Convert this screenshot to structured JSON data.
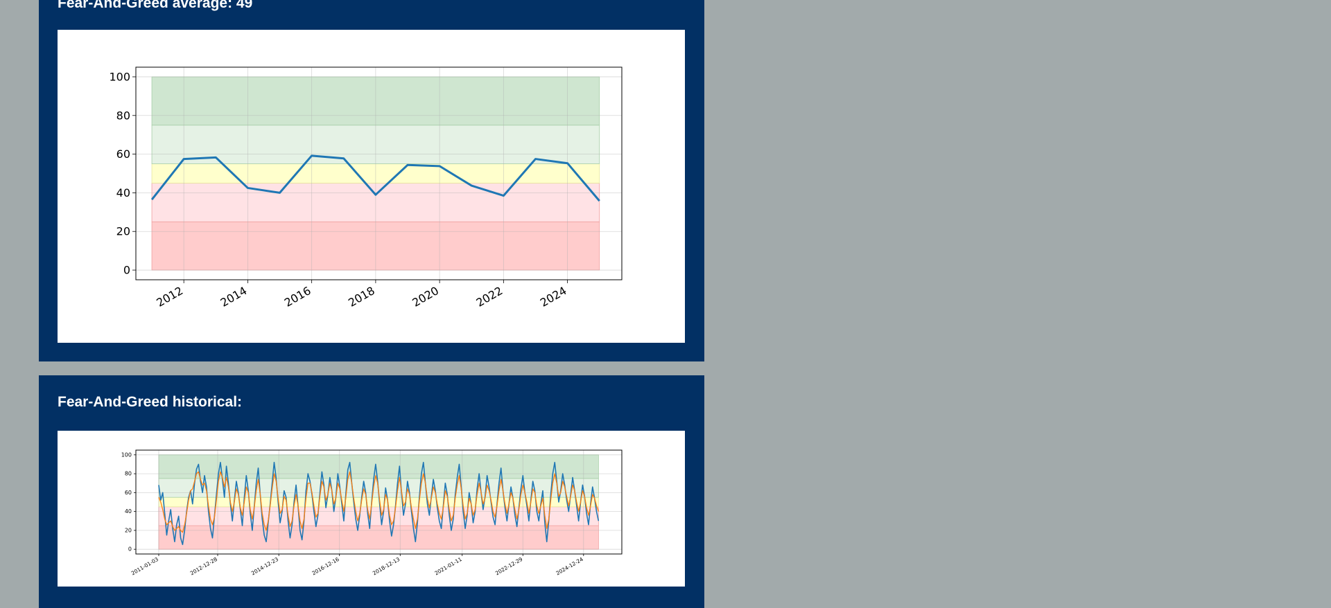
{
  "avg_panel": {
    "title": "Fear-And-Greed average: 49"
  },
  "hist_panel": {
    "title": "Fear-And-Greed historical:"
  },
  "colors": {
    "panel_bg": "#023064",
    "page_bg": "#a2aaab",
    "line": "#1f77b4",
    "ma_line": "#ff7f0e",
    "extreme_greed_band": "#cfe6d0",
    "greed_band": "#e5f2e5",
    "neutral_band": "#ffffcc",
    "fear_band": "#ffe2e5",
    "extreme_fear_band": "#ffcccc"
  },
  "chart_data": [
    {
      "type": "line",
      "title": "",
      "x": [
        2011,
        2012,
        2013,
        2014,
        2015,
        2016,
        2017,
        2018,
        2019,
        2020,
        2021,
        2022,
        2023,
        2024,
        2025
      ],
      "series": [
        {
          "values": [
            36.5,
            57.5,
            58.3,
            42.5,
            40.0,
            59.2,
            57.8,
            39.0,
            54.4,
            53.8,
            43.7,
            38.5,
            57.5,
            55.3,
            35.8
          ]
        }
      ],
      "bands": [
        {
          "from": 0,
          "to": 25,
          "color": "#ffcccc"
        },
        {
          "from": 25,
          "to": 45,
          "color": "#ffe2e5"
        },
        {
          "from": 45,
          "to": 55,
          "color": "#ffffcc"
        },
        {
          "from": 55,
          "to": 75,
          "color": "#e5f2e5"
        },
        {
          "from": 75,
          "to": 100,
          "color": "#cfe6d0"
        }
      ],
      "xticks": [
        "2012",
        "2014",
        "2016",
        "2018",
        "2020",
        "2022",
        "2024"
      ],
      "yticks": [
        0,
        20,
        40,
        60,
        80,
        100
      ],
      "xlim": [
        2010.5,
        2025.7
      ],
      "ylim": [
        -5,
        105
      ],
      "grid": true
    },
    {
      "type": "line",
      "title": "",
      "x_start": "2011-01-03",
      "x_end": "2025-01-06",
      "xticks": [
        "2011-01-03",
        "2012-12-28",
        "2014-12-23",
        "2016-12-16",
        "2018-12-13",
        "2021-01-11",
        "2022-12-29",
        "2024-12-24"
      ],
      "yticks": [
        0,
        20,
        40,
        60,
        80,
        100
      ],
      "ylim": [
        -5,
        105
      ],
      "grid": true,
      "series": [
        {
          "values": [
            68,
            52,
            60,
            38,
            15,
            30,
            42,
            22,
            8,
            26,
            35,
            12,
            5,
            20,
            40,
            55,
            62,
            48,
            70,
            85,
            90,
            72,
            60,
            78,
            66,
            40,
            22,
            12,
            35,
            58,
            80,
            92,
            74,
            55,
            88,
            70,
            48,
            30,
            52,
            72,
            60,
            42,
            25,
            55,
            78,
            62,
            38,
            20,
            45,
            70,
            86,
            58,
            32,
            15,
            8,
            28,
            48,
            70,
            92,
            75,
            50,
            28,
            40,
            62,
            55,
            30,
            12,
            26,
            50,
            68,
            46,
            20,
            10,
            30,
            62,
            80,
            72,
            58,
            40,
            24,
            36,
            60,
            82,
            68,
            44,
            58,
            76,
            62,
            40,
            55,
            80,
            66,
            48,
            30,
            58,
            84,
            92,
            70,
            50,
            32,
            20,
            36,
            55,
            72,
            60,
            38,
            22,
            50,
            74,
            90,
            72,
            48,
            26,
            40,
            65,
            52,
            30,
            14,
            26,
            46,
            70,
            88,
            60,
            36,
            48,
            72,
            60,
            40,
            22,
            8,
            28,
            56,
            80,
            92,
            70,
            48,
            36,
            56,
            74,
            62,
            44,
            30,
            22,
            46,
            70,
            58,
            36,
            20,
            32,
            58,
            76,
            90,
            66,
            40,
            22,
            36,
            60,
            48,
            28,
            40,
            64,
            80,
            60,
            42,
            56,
            78,
            66,
            50,
            34,
            26,
            48,
            70,
            86,
            62,
            44,
            30,
            48,
            66,
            54,
            36,
            24,
            44,
            64,
            78,
            60,
            46,
            30,
            52,
            72,
            62,
            40,
            30,
            48,
            62,
            28,
            8,
            30,
            58,
            80,
            92,
            72,
            50,
            62,
            80,
            68,
            52,
            40,
            58,
            76,
            62,
            46,
            30,
            50,
            68,
            56,
            38,
            26,
            48,
            66,
            54,
            40,
            30
          ],
          "color": "#1f77b4"
        },
        {
          "values": [
            55,
            50,
            42,
            32,
            26,
            28,
            30,
            24,
            20,
            22,
            24,
            20,
            18,
            26,
            38,
            52,
            62,
            64,
            72,
            80,
            82,
            74,
            68,
            70,
            62,
            46,
            32,
            26,
            34,
            52,
            72,
            82,
            76,
            66,
            76,
            66,
            50,
            40,
            50,
            64,
            58,
            44,
            36,
            50,
            66,
            60,
            42,
            32,
            44,
            62,
            74,
            58,
            38,
            26,
            20,
            30,
            46,
            64,
            80,
            72,
            54,
            38,
            42,
            56,
            52,
            36,
            24,
            30,
            46,
            58,
            46,
            30,
            22,
            32,
            54,
            70,
            70,
            60,
            46,
            34,
            38,
            56,
            72,
            66,
            52,
            58,
            70,
            62,
            48,
            54,
            70,
            64,
            52,
            40,
            54,
            74,
            82,
            70,
            54,
            40,
            30,
            38,
            52,
            64,
            58,
            42,
            32,
            48,
            66,
            78,
            70,
            52,
            36,
            42,
            58,
            52,
            36,
            26,
            30,
            44,
            62,
            76,
            62,
            46,
            50,
            64,
            58,
            44,
            32,
            22,
            32,
            52,
            70,
            80,
            70,
            54,
            44,
            54,
            66,
            60,
            48,
            38,
            32,
            44,
            62,
            56,
            42,
            30,
            36,
            54,
            68,
            78,
            64,
            46,
            32,
            38,
            54,
            48,
            36,
            42,
            58,
            70,
            60,
            48,
            54,
            68,
            62,
            52,
            40,
            34,
            46,
            62,
            74,
            62,
            48,
            38,
            48,
            60,
            54,
            42,
            32,
            42,
            58,
            68,
            60,
            50,
            38,
            50,
            64,
            60,
            46,
            38,
            46,
            54,
            36,
            22,
            32,
            52,
            70,
            80,
            70,
            56,
            60,
            72,
            66,
            56,
            46,
            56,
            68,
            62,
            50,
            40,
            50,
            62,
            56,
            44,
            36,
            46,
            58,
            54,
            46,
            40
          ],
          "color": "#ff7f0e"
        }
      ]
    }
  ]
}
